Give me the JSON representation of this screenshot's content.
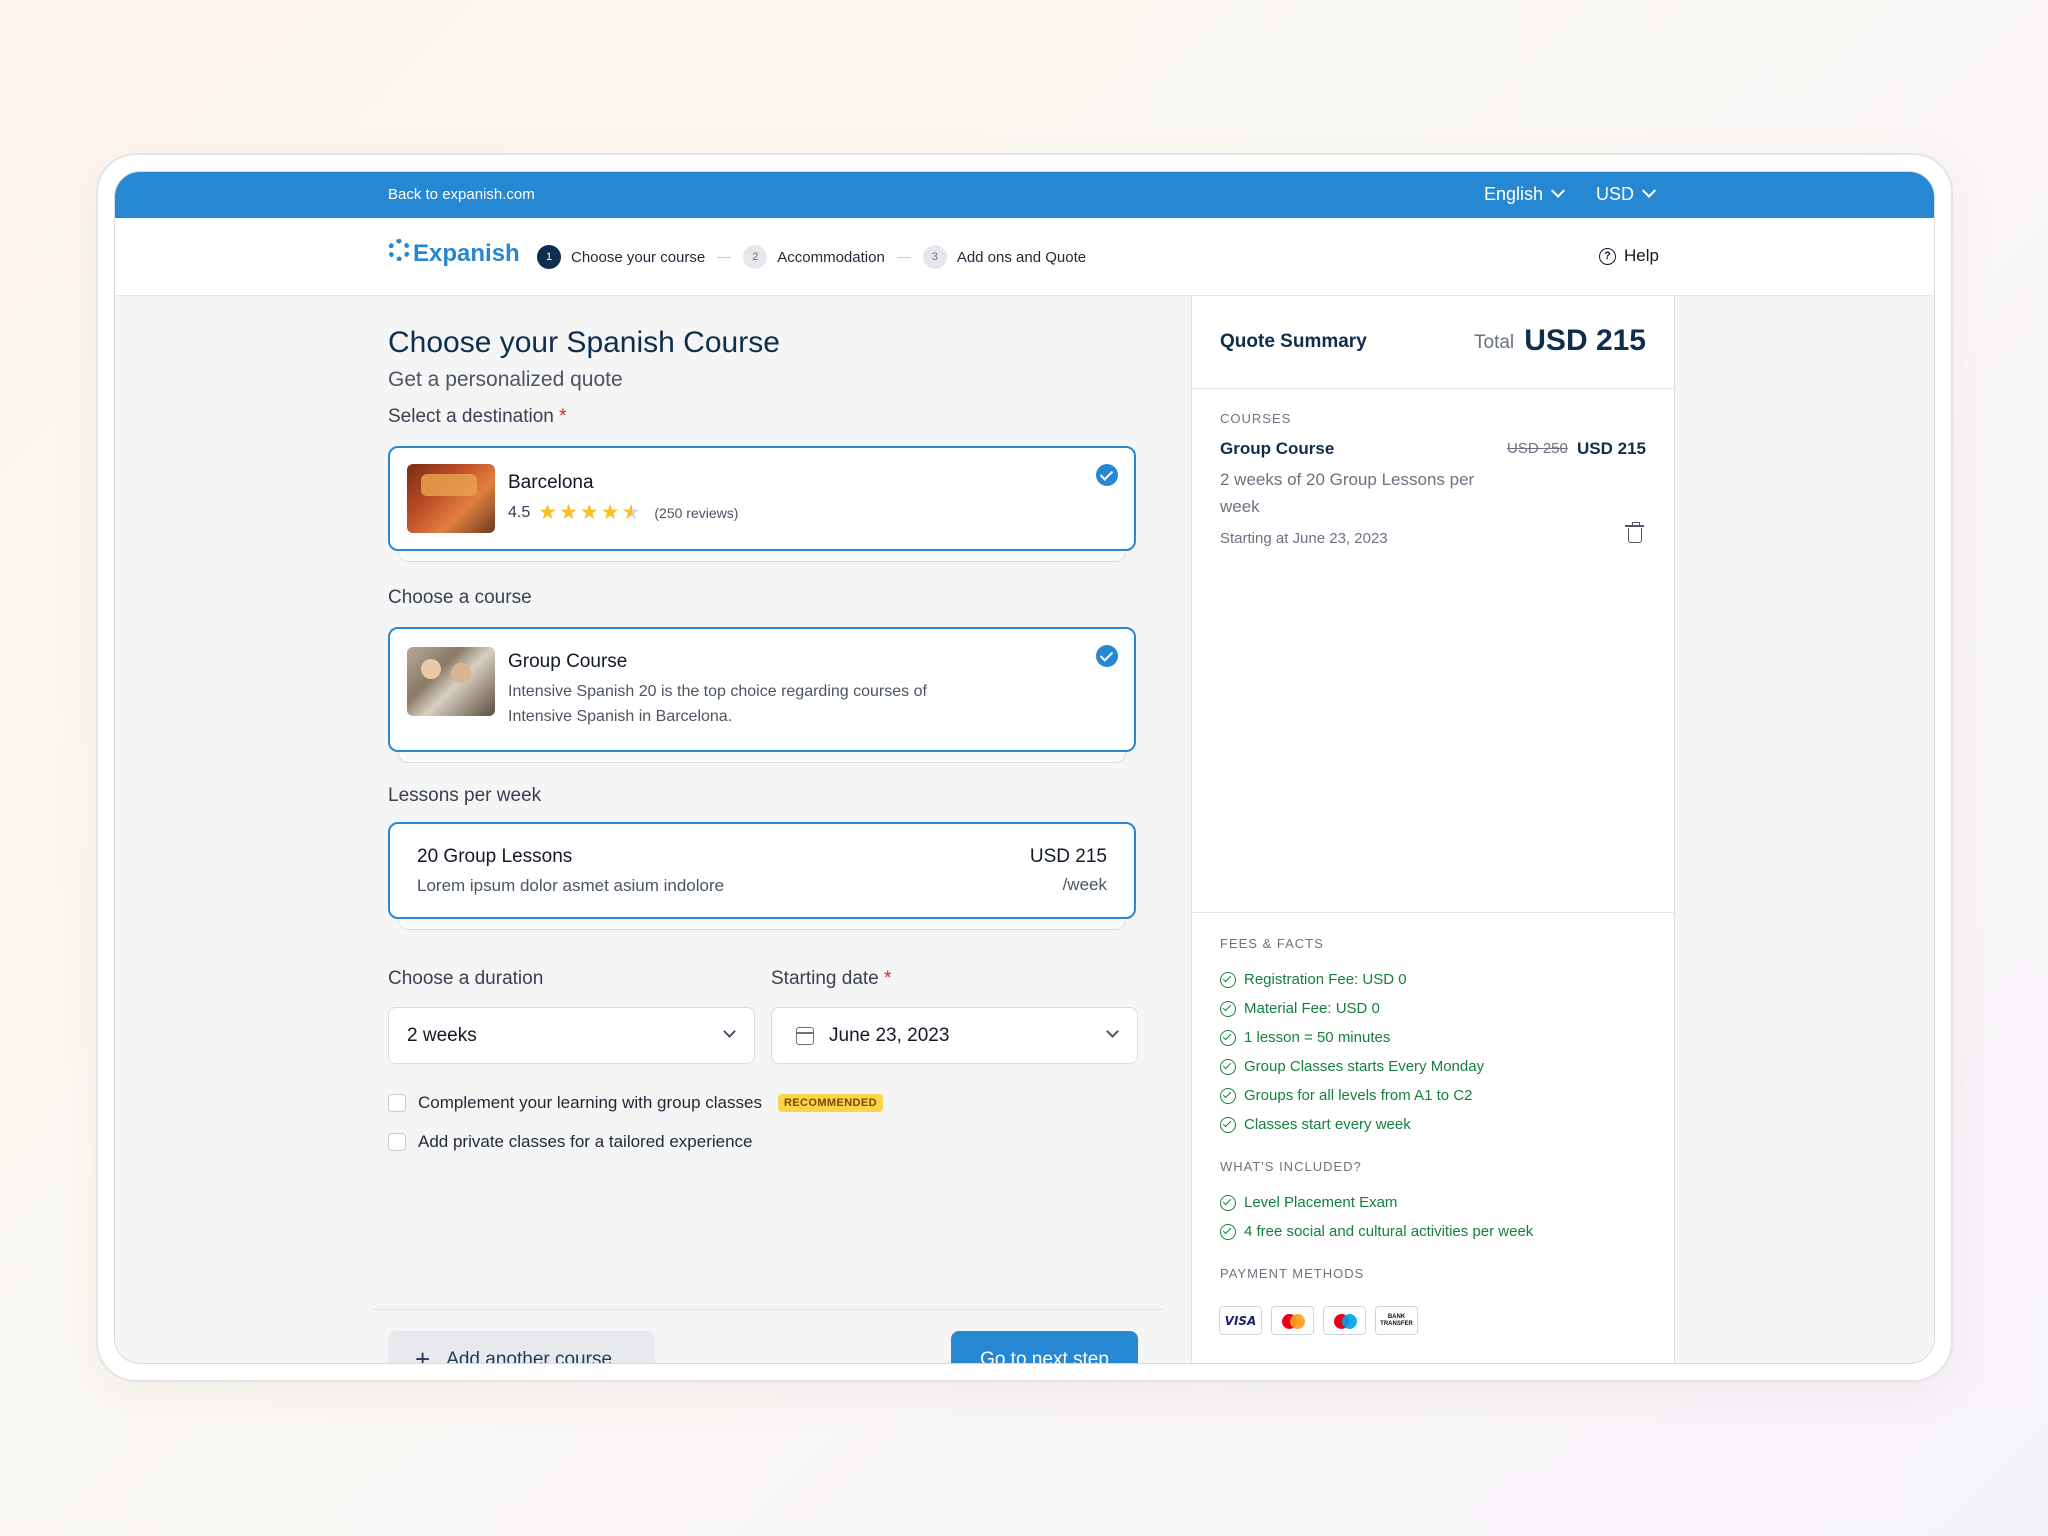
{
  "topbar": {
    "back_link": "Back to expanish.com",
    "language": "English",
    "currency": "USD"
  },
  "header": {
    "logo_text": "Expanish",
    "steps": [
      {
        "num": "1",
        "label": "Choose your course"
      },
      {
        "num": "2",
        "label": "Accommodation"
      },
      {
        "num": "3",
        "label": "Add ons and Quote"
      }
    ],
    "help_label": "Help"
  },
  "main": {
    "title": "Choose your Spanish Course",
    "subtitle": "Get a personalized quote",
    "destination": {
      "label": "Select a destination",
      "required": "*",
      "name": "Barcelona",
      "rating": "4.5",
      "rating_value": 4.5,
      "reviews": "(250 reviews)"
    },
    "course": {
      "label": "Choose a course",
      "name": "Group Course",
      "description": "Intensive Spanish 20 is the top choice regarding courses of Intensive Spanish in Barcelona."
    },
    "lessons": {
      "label": "Lessons per week",
      "name": "20 Group Lessons",
      "description": "Lorem ipsum dolor asmet asium indolore",
      "price": "USD 215",
      "unit": "/week"
    },
    "duration": {
      "label": "Choose a duration",
      "value": "2 weeks"
    },
    "start_date": {
      "label": "Starting date",
      "required": "*",
      "value": "June 23, 2023"
    },
    "options": {
      "group_text": "Complement your learning with group classes",
      "group_badge": "RECOMMENDED",
      "private_bold": "Add private classes",
      "private_rest": " for a tailored experience"
    },
    "add_course_label": "Add another course",
    "next_step_label": "Go to next step"
  },
  "sidebar": {
    "title": "Quote Summary",
    "total_label": "Total",
    "total_value": "USD 215",
    "courses_heading": "COURSES",
    "course_name": "Group Course",
    "old_price": "USD 250",
    "price": "USD 215",
    "course_desc": "2 weeks of 20 Group Lessons per week",
    "start_text": "Starting at June 23, 2023",
    "fees_heading": "FEES & FACTS",
    "fees": [
      "Registration Fee: USD 0",
      "Material Fee: USD 0",
      "1 lesson = 50 minutes",
      "Group Classes starts Every Monday",
      "Groups for all levels from A1 to C2",
      "Classes start every week"
    ],
    "included_heading": "WHAT'S INCLUDED?",
    "included": [
      "Level Placement Exam",
      "4 free social and cultural activities per week"
    ],
    "payment_heading": "PAYMENT METHODS",
    "payment": {
      "visa": "VISA",
      "bank": "BANK TRANSFER"
    }
  },
  "colors": {
    "primary": "#2687d3",
    "navy": "#0f2e4d",
    "success": "#15803d",
    "badge": "#fbd449"
  }
}
